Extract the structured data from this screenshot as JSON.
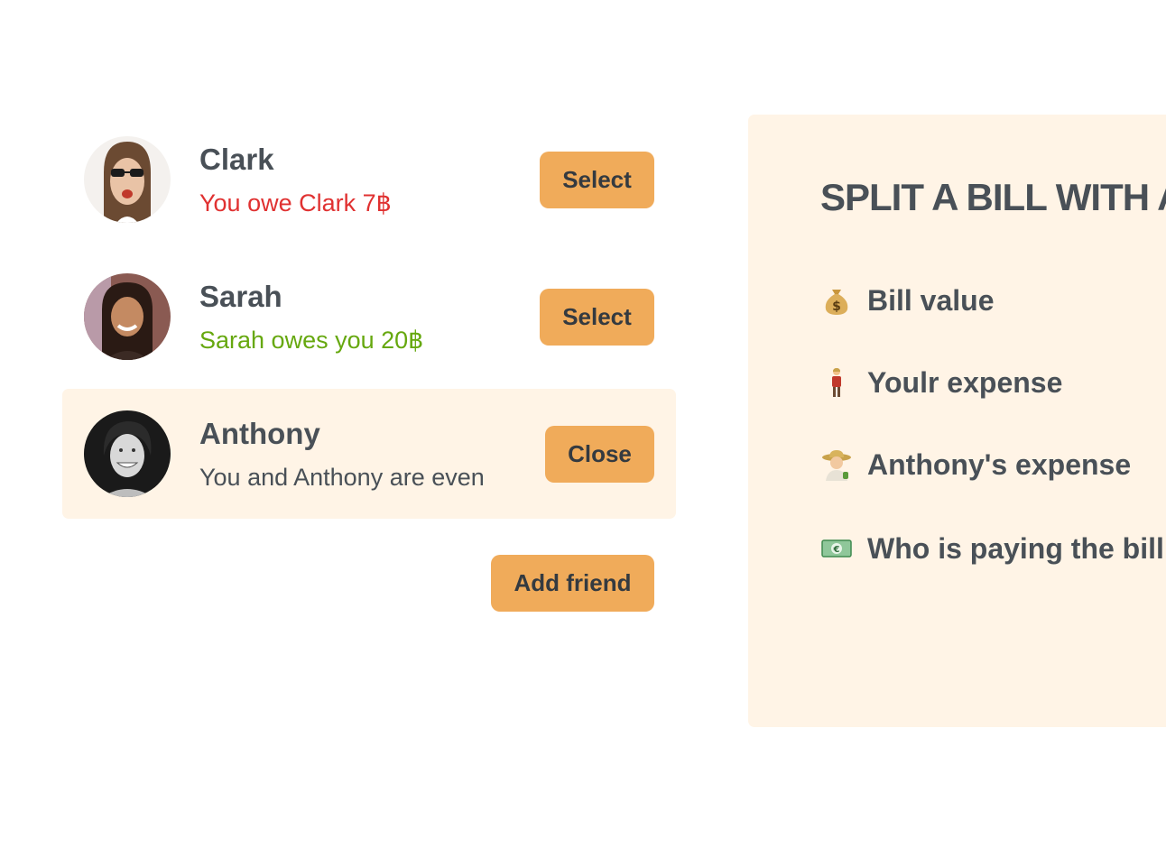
{
  "friends": [
    {
      "name": "Clark",
      "status": "You owe Clark 7฿",
      "status_color": "#e03131",
      "button_label": "Select",
      "selected": false
    },
    {
      "name": "Sarah",
      "status": "Sarah owes you 20฿",
      "status_color": "#66a80f",
      "button_label": "Select",
      "selected": false
    },
    {
      "name": "Anthony",
      "status": "You and Anthony are even",
      "status_color": "#495057",
      "button_label": "Close",
      "selected": true
    }
  ],
  "add_friend_label": "Add friend",
  "split_form": {
    "title": "SPLIT A BILL WITH ANTHONY",
    "rows": [
      {
        "icon": "money-bag-icon",
        "label": "Bill value"
      },
      {
        "icon": "person-standing-icon",
        "label": "Youlr expense"
      },
      {
        "icon": "farmer-icon",
        "label": "Anthony's expense"
      },
      {
        "icon": "euro-banknote-icon",
        "label": "Who is paying the bill"
      }
    ]
  },
  "colors": {
    "accent": "#f0ab5a",
    "panel_bg": "#fff4e6",
    "text": "#495057",
    "negative": "#e03131",
    "positive": "#66a80f"
  }
}
